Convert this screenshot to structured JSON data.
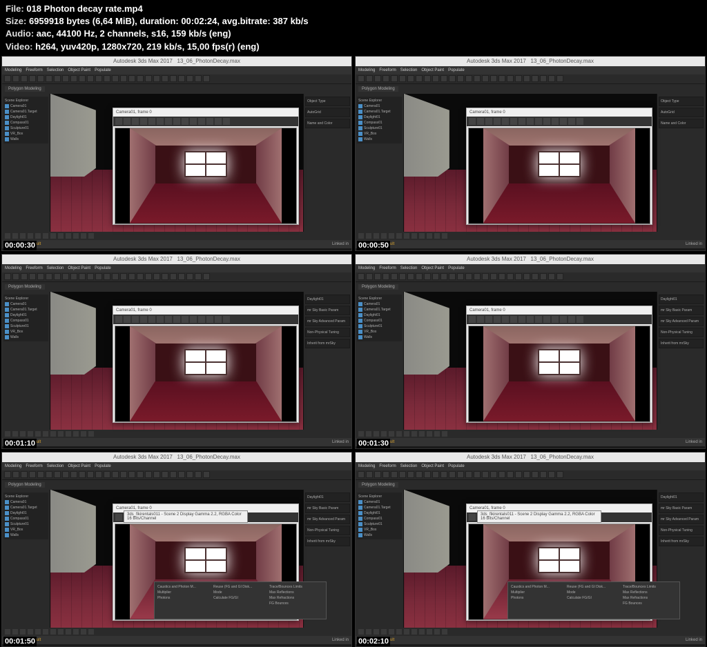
{
  "header": {
    "file_label": "File: ",
    "file_value": "018 Photon decay rate.mp4",
    "size_label": "Size: ",
    "size_value": "6959918 bytes (6,64 MiB), duration: 00:02:24, avg.bitrate: 387 kb/s",
    "audio_label": "Audio: ",
    "audio_value": "aac, 44100 Hz, 2 channels, s16, 159 kb/s (eng)",
    "video_label": "Video: ",
    "video_value": "h264, yuv420p, 1280x720, 219 kb/s, 15,00 fps(r) (eng)"
  },
  "thumbs": [
    {
      "ts": "00:00:30",
      "type": "render",
      "panel": "create"
    },
    {
      "ts": "00:00:50",
      "type": "render",
      "panel": "create"
    },
    {
      "ts": "00:01:10",
      "type": "render",
      "panel": "settings"
    },
    {
      "ts": "00:01:30",
      "type": "render",
      "panel": "settings"
    },
    {
      "ts": "00:01:50",
      "type": "render-bright",
      "panel": "settings",
      "popup": true
    },
    {
      "ts": "00:02:10",
      "type": "render-bright",
      "panel": "settings",
      "popup": true
    }
  ],
  "app_title": "Autodesk 3ds Max 2017",
  "file_open": "13_06_PhotonDecay.max",
  "menus": [
    "Modeling",
    "Freeform",
    "Selection",
    "Object Paint",
    "Populate"
  ],
  "tabs": [
    "Polygon Modeling"
  ],
  "render_title": "Camera01, frame 0",
  "scene_items": [
    "Camera01",
    "Camera01.Target",
    "Daylight01",
    "Compass01",
    "Sculpture01",
    "VR_Box",
    "Walls"
  ],
  "right_panels": {
    "create": [
      "Object Type",
      "AutoGrid",
      "Name and Color"
    ],
    "settings": [
      "Daylight01",
      "mr Sky Basic Param",
      "mr Sky Advanced Param",
      "Non-Physical Tuning",
      "Inherit from mrSky"
    ]
  },
  "popup": {
    "cols": [
      [
        "Caustics and Photon M...",
        "Multiplier",
        "Photons"
      ],
      [
        "Reuse (FG and GI Disk...",
        "Mode",
        "Calculate FG/GI"
      ],
      [
        "Trace/Bounces Limits",
        "Max Reflections",
        "Max Refractions",
        "FG Bounces"
      ]
    ]
  },
  "workspace": "Workspace: Default",
  "browser_title": "3ds_fikirentals011 - Scene 2 Display Gamma 2.2, RGBA Color 16 Bits/Channel"
}
